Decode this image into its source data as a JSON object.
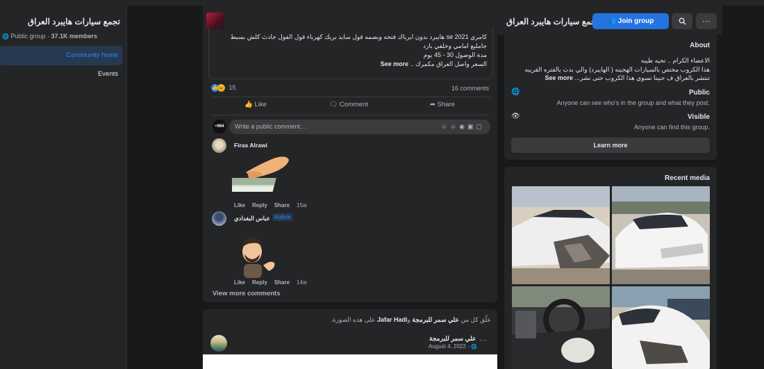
{
  "sidebar": {
    "group_name": "تجمع سيارات هايبرد العراق",
    "privacy": "Public group",
    "members": "37.1K members",
    "items": [
      {
        "label": "Community home"
      },
      {
        "label": "Events"
      }
    ]
  },
  "header": {
    "group_name": "تجمع سيارات هايبرد العراق",
    "join_label": "Join group",
    "search_icon": "search-icon",
    "more_icon": "more-icon",
    "more_text": "···"
  },
  "post": {
    "line1": "كامري 2021 se هايبرد بدون ايرباك فتحه وبصمه فول سايد بريك كهرباء فول الفول حادث كلش بسيط",
    "line2": "جامليع امامي وخلفي بارد",
    "line3": "مدة الوصول 30 - 45 يوم",
    "line4": "السعر واصل العراق مكمرك ..",
    "see_more": "See more",
    "reaction_count": "15",
    "comments_count": "16 comments",
    "actions": {
      "like": "Like",
      "comment": "Comment",
      "share": "Share"
    },
    "comment_placeholder": "Write a public comment...",
    "comments": [
      {
        "name": "Firas Alrawi",
        "like": "Like",
        "reply": "Reply",
        "share": "Share",
        "time": "15w"
      },
      {
        "name": "عباس البغدادي",
        "badge": "Author",
        "like": "Like",
        "reply": "Reply",
        "share": "Share",
        "time": "14w"
      }
    ],
    "view_more": "View more comments"
  },
  "post2": {
    "activity_prefix": "علّق كل من",
    "activity_user1": "علي سمر للبرمجة",
    "activity_and": "و",
    "activity_user2": "Jafar Hadi",
    "activity_suffix": "على هذه الصورة.",
    "author": "علي سمر للبرمجة",
    "date": "August 4, 2022 ·",
    "more": "···"
  },
  "about": {
    "title": "About",
    "desc1": "الاعضاء الكرام .. تحيه طيبه",
    "desc2": "هذا الكروب مختص بالسيارات الهجينه ( الهايبرد) والي بدت بالفتره القريبه",
    "desc3": "تنتشر بالعراق ف حبينا نسوي هذا الكروب حتى نشر...",
    "see_more": "See more",
    "public_title": "Public",
    "public_desc": "Anyone can see who's in the group and what they post.",
    "visible_title": "Visible",
    "visible_desc": "Anyone can find this group.",
    "learn_more": "Learn more"
  },
  "recent_media": {
    "title": "Recent media"
  },
  "colors": {
    "accent": "#2374e1",
    "bg": "#18191a",
    "card": "#242526"
  }
}
